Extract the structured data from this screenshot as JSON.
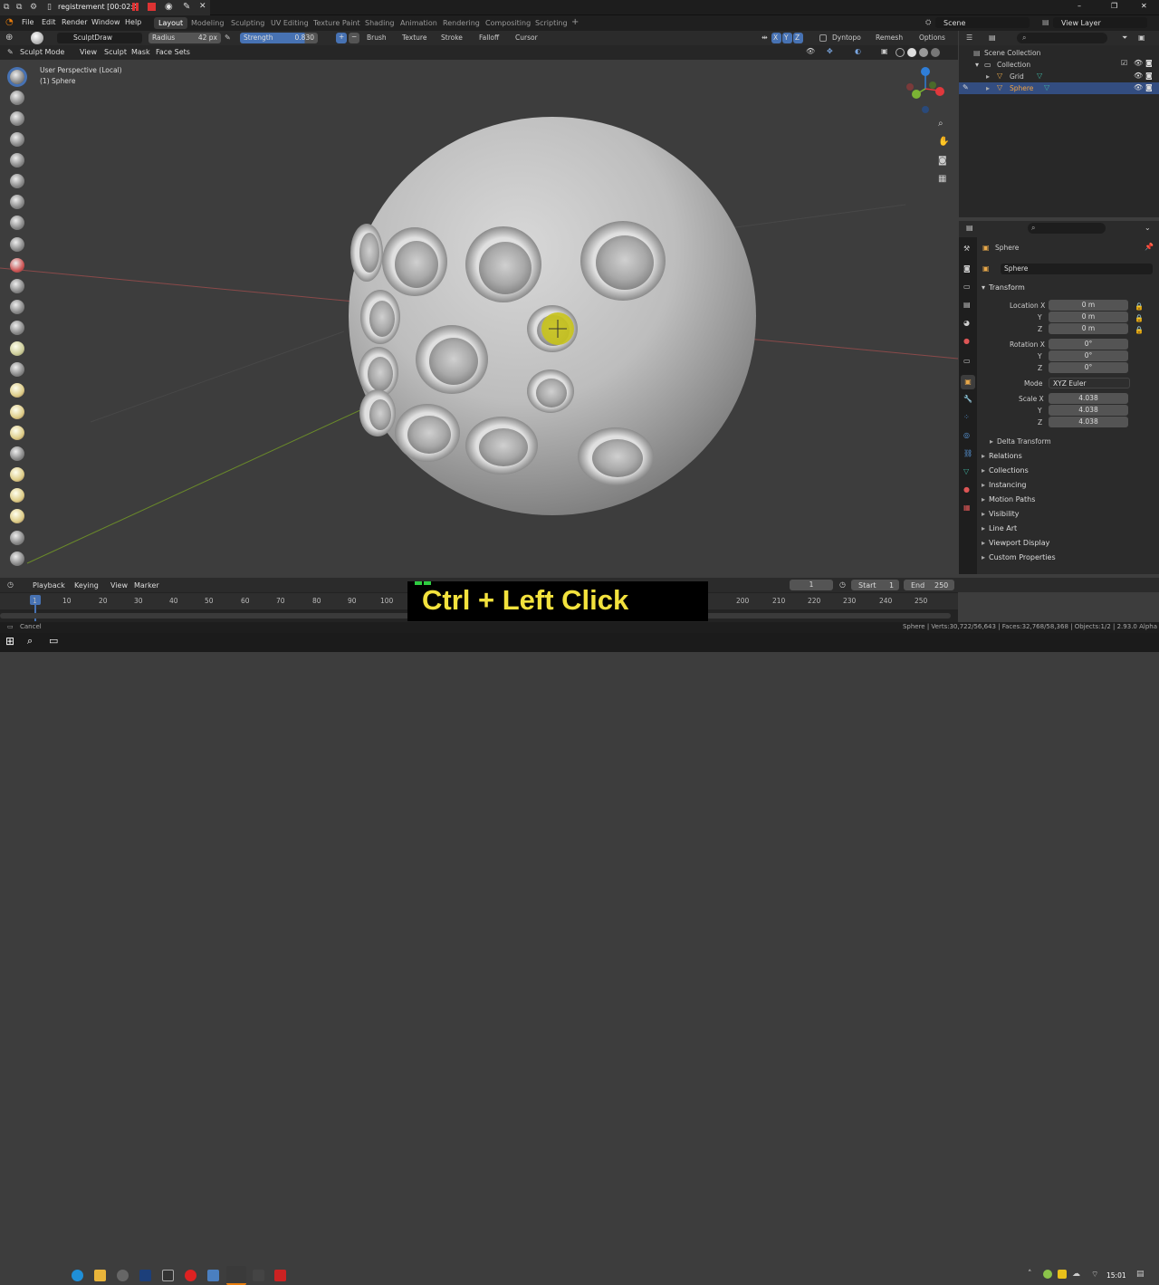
{
  "window": {
    "recording_title": "registrement [00:02:4",
    "controls": {
      "minimize": "–",
      "restore": "❐",
      "close": "✕"
    }
  },
  "menubar": {
    "items": [
      "File",
      "Edit",
      "Render",
      "Window",
      "Help"
    ],
    "workspaces": [
      "Layout",
      "Modeling",
      "Sculpting",
      "UV Editing",
      "Texture Paint",
      "Shading",
      "Animation",
      "Rendering",
      "Compositing",
      "Scripting"
    ],
    "add_tab": "+",
    "scene_label": "Scene",
    "view_layer_label": "View Layer"
  },
  "tool_header": {
    "brush_name": "SculptDraw",
    "radius_label": "Radius",
    "radius_value": "42 px",
    "strength_label": "Strength",
    "strength_value": "0.830",
    "plus": "+",
    "minus": "−",
    "dropdowns": [
      "Brush",
      "Texture",
      "Stroke",
      "Falloff",
      "Cursor"
    ],
    "axes": [
      "X",
      "Y",
      "Z"
    ],
    "dyntopo": "Dyntopo",
    "remesh": "Remesh",
    "options": "Options"
  },
  "mode_header": {
    "mode": "Sculpt Mode",
    "items": [
      "View",
      "Sculpt",
      "Mask",
      "Face Sets"
    ]
  },
  "viewport": {
    "perspective": "User Perspective (Local)",
    "object": "(1) Sphere",
    "gizmo_colors": {
      "x": "#e0383c",
      "y": "#7bb334",
      "z": "#2f7ed8"
    }
  },
  "outliner": {
    "root": "Scene Collection",
    "collection": "Collection",
    "items": [
      {
        "name": "Grid",
        "selected": false
      },
      {
        "name": "Sphere",
        "selected": true
      }
    ]
  },
  "properties": {
    "object_name": "Sphere",
    "data_name": "Sphere",
    "transform_title": "Transform",
    "location": {
      "label": "Location X",
      "y_label": "Y",
      "z_label": "Z",
      "x": "0 m",
      "y": "0 m",
      "z": "0 m"
    },
    "rotation": {
      "label": "Rotation X",
      "y_label": "Y",
      "z_label": "Z",
      "x": "0°",
      "y": "0°",
      "z": "0°"
    },
    "mode_label": "Mode",
    "mode_value": "XYZ Euler",
    "scale": {
      "label": "Scale X",
      "y_label": "Y",
      "z_label": "Z",
      "x": "4.038",
      "y": "4.038",
      "z": "4.038"
    },
    "delta_transform": "Delta Transform",
    "panels": [
      "Relations",
      "Collections",
      "Instancing",
      "Motion Paths",
      "Visibility",
      "Line Art",
      "Viewport Display",
      "Custom Properties"
    ]
  },
  "timeline": {
    "menus": [
      "Playback",
      "Keying",
      "View",
      "Marker"
    ],
    "current_frame": "1",
    "start_label": "Start",
    "start_value": "1",
    "end_label": "End",
    "end_value": "250",
    "ticks": [
      "1",
      "10",
      "20",
      "30",
      "40",
      "50",
      "60",
      "70",
      "80",
      "90",
      "100",
      "200",
      "210",
      "220",
      "230",
      "240",
      "250"
    ]
  },
  "keycast": {
    "text": "Ctrl + Left Click"
  },
  "statusbar": {
    "left": "Cancel",
    "right": "Sphere | Verts:30,722/56,643 | Faces:32,768/58,368 | Objects:1/2 | 2.93.0 Alpha"
  },
  "taskbar": {
    "time": "15:01"
  }
}
